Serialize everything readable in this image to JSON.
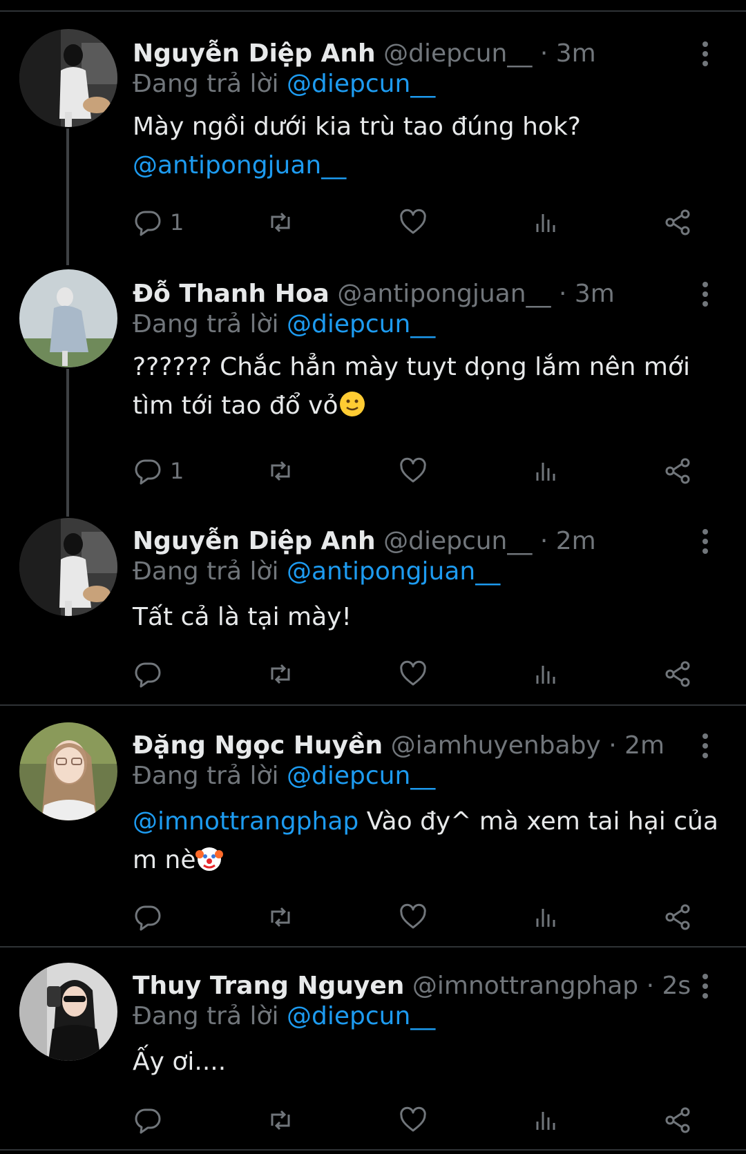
{
  "reply_prefix": "Đang trả lời",
  "tweets": [
    {
      "name": "Nguyễn Diệp Anh",
      "handle": "@diepcun__",
      "separator": "·",
      "time": "3m",
      "reply_to": "@diepcun__",
      "mention": "",
      "text": "Mày ngồi dưới kia trù tao đúng hok?",
      "trailing_mention": "@antipongjuan__",
      "emoji": "",
      "reply_count": "1"
    },
    {
      "name": "Đỗ Thanh Hoa",
      "handle": "@antipongjuan__",
      "separator": "·",
      "time": "3m",
      "reply_to": "@diepcun__",
      "mention": "",
      "text": "?????? Chắc hẳn mày tuyt dọng lắm nên mới tìm tới tao đổ vỏ",
      "trailing_mention": "",
      "emoji": "slightly-smiling-face",
      "reply_count": "1"
    },
    {
      "name": "Nguyễn Diệp Anh",
      "handle": "@diepcun__",
      "separator": "·",
      "time": "2m",
      "reply_to": "@antipongjuan__",
      "mention": "",
      "text": "Tất cả là tại mày!",
      "trailing_mention": "",
      "emoji": "",
      "reply_count": ""
    },
    {
      "name": "Đặng Ngọc Huyền",
      "handle": "@iamhuyenbaby",
      "separator": "·",
      "time": "2m",
      "reply_to": "@diepcun__",
      "mention": "@imnottrangphap",
      "text": " Vào đy^ mà xem tai hại của m nè",
      "trailing_mention": "",
      "emoji": "clown-face",
      "reply_count": ""
    },
    {
      "name": "Thuy Trang Nguyen",
      "handle": "@imnottrangphap",
      "separator": "·",
      "time": "2s",
      "reply_to": "@diepcun__",
      "mention": "",
      "text": "Ấy ơi....",
      "trailing_mention": "",
      "emoji": "",
      "reply_count": ""
    }
  ],
  "icons": {
    "reply": "reply-icon",
    "retweet": "retweet-icon",
    "like": "like-icon",
    "views": "views-icon",
    "share": "share-icon",
    "more": "more-icon"
  },
  "colors": {
    "background": "#000000",
    "text": "#e7e9ea",
    "muted": "#71767b",
    "link": "#1d9bf0"
  }
}
